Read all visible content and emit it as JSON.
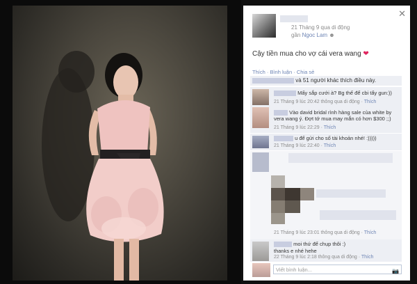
{
  "viewer": {
    "close_icon": "✕"
  },
  "post": {
    "timestamp": "21 Tháng 9 qua di động",
    "location_prefix": "gần",
    "location": "Ngoc Lam",
    "caption": "Cậy tiền mua cho vợ cái vera wang",
    "actions": {
      "like": "Thích",
      "comment": "Bình luận",
      "share": "Chia sẻ"
    },
    "likes_text": "và 51 người khác thích điều này."
  },
  "comments": [
    {
      "text": "Mấy sắp cưới à? Bg thế để cbi tẩy gun:))",
      "time": "21 Tháng 9 lúc 20:42 thông qua di động",
      "like": "Thích"
    },
    {
      "text": "Vào david bridal rình hàng sale của white by vera wang ý. Đợt tớ mua may mắn có hơn $300 ;;)",
      "time": "21 Tháng 9 lúc 22:29",
      "like": "Thích"
    },
    {
      "text": "u để gửi cho số tài khoản nhé! :)))))",
      "time": "21 Tháng 9 lúc 22:40",
      "like": "Thích"
    },
    {
      "text": "",
      "time": "21 Tháng 9 lúc 23:01 thông qua di động",
      "like": "Thích"
    },
    {
      "text": "moi thứ để chụp thôi :)",
      "text2": "thanks e nhé hehe",
      "time": "22 Tháng 9 lúc 2:18 thông qua di động",
      "like": "Thích"
    }
  ],
  "comment_input": {
    "placeholder": "Viết bình luận..."
  },
  "colors": {
    "link": "#6d84b4",
    "panel_bg": "#ffffff",
    "comment_bg": "#edeff4",
    "heart": "#e0245e"
  }
}
